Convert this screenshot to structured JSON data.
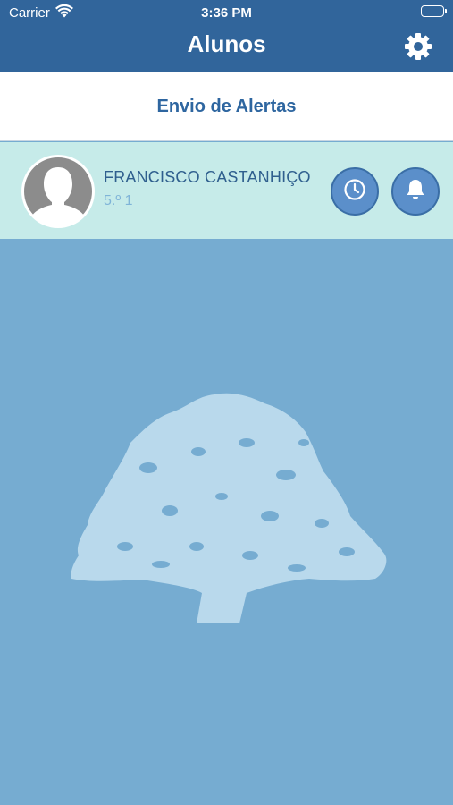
{
  "status_bar": {
    "carrier": "Carrier",
    "time": "3:36 PM",
    "wifi_icon": "wifi-icon",
    "battery_icon": "battery-icon"
  },
  "nav": {
    "title": "Alunos",
    "settings_icon": "gear-icon"
  },
  "alerts": {
    "label": "Envio de Alertas"
  },
  "student": {
    "name": "FRANCISCO CASTANHIÇO",
    "class": "5.º 1",
    "avatar_icon": "person-avatar-icon",
    "schedule_icon": "clock-icon",
    "alert_icon": "bell-icon"
  },
  "background_icon": "tree-icon",
  "colors": {
    "nav_bg": "#31659b",
    "alerts_text": "#2e66a0",
    "student_bg": "#c6ebe9",
    "button_bg": "#5b8fca",
    "page_bg": "#76acd1",
    "tree": "#b9d9ec"
  }
}
